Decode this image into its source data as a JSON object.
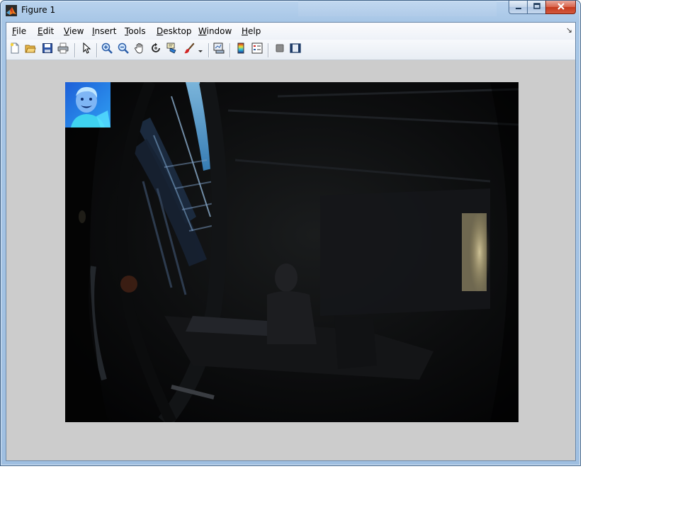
{
  "window": {
    "title": "Figure 1",
    "controls": {
      "minimize": "minimize",
      "maximize": "maximize",
      "close": "close"
    }
  },
  "menubar": {
    "items": [
      {
        "label": "File",
        "accel": "F",
        "rest": "ile"
      },
      {
        "label": "Edit",
        "accel": "E",
        "rest": "dit"
      },
      {
        "label": "View",
        "accel": "V",
        "rest": "iew"
      },
      {
        "label": "Insert",
        "accel": "I",
        "rest": "nsert"
      },
      {
        "label": "Tools",
        "accel": "T",
        "rest": "ools"
      },
      {
        "label": "Desktop",
        "accel": "D",
        "rest": "esktop"
      },
      {
        "label": "Window",
        "accel": "W",
        "rest": "indow"
      },
      {
        "label": "Help",
        "accel": "H",
        "rest": "elp"
      }
    ],
    "dock_glyph": "↘"
  },
  "toolbar": {
    "buttons": [
      {
        "name": "new-figure",
        "icon": "new-file-icon"
      },
      {
        "name": "open-file",
        "icon": "folder-open-icon"
      },
      {
        "name": "save-figure",
        "icon": "save-icon"
      },
      {
        "name": "print-figure",
        "icon": "printer-icon"
      },
      {
        "name": "edit-plot",
        "icon": "pointer-arrow-icon"
      },
      {
        "name": "zoom-in",
        "icon": "zoom-in-icon"
      },
      {
        "name": "zoom-out",
        "icon": "zoom-out-icon"
      },
      {
        "name": "pan",
        "icon": "hand-icon"
      },
      {
        "name": "rotate-3d",
        "icon": "rotate-icon"
      },
      {
        "name": "data-cursor",
        "icon": "data-cursor-icon"
      },
      {
        "name": "brush",
        "icon": "brush-icon"
      },
      {
        "name": "link-plot",
        "icon": "link-plot-icon"
      },
      {
        "name": "insert-colorbar",
        "icon": "colorbar-icon"
      },
      {
        "name": "insert-legend",
        "icon": "legend-icon"
      },
      {
        "name": "hide-plot-tools",
        "icon": "hide-tools-icon"
      },
      {
        "name": "show-plot-tools",
        "icon": "show-tools-icon"
      }
    ]
  },
  "figure": {
    "image_description_icon": "fisheye-office-photo",
    "thumbnail_icon": "child-portrait-thumbnail"
  },
  "colors": {
    "title_bar": "#b9d3ee",
    "figure_background": "#cccccc",
    "close_button": "#c4391d",
    "thumbnail_blue": "#2f7fe6"
  }
}
